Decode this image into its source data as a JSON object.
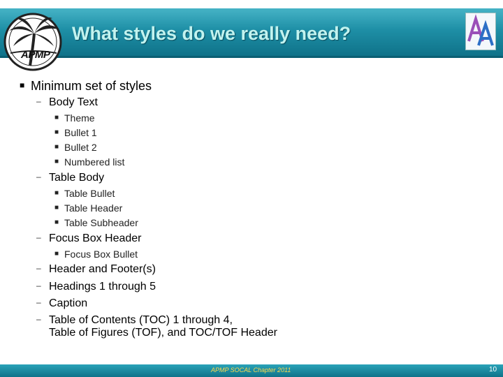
{
  "slide": {
    "title": "What styles do we really need?",
    "logo_text": "APMP",
    "logo_ring_text": "SOCAL CHAPTER",
    "footer": "APMP SOCAL Chapter 2011",
    "page_number": "10",
    "colors": {
      "band": "#1e8fa6",
      "title": "#c2f3ef",
      "footer_text": "#ffd84a"
    }
  },
  "bullets": {
    "main": "Minimum set of styles",
    "body_text": "Body Text",
    "body_sub": [
      "Theme",
      "Bullet 1",
      "Bullet 2",
      "Numbered list"
    ],
    "table_body": "Table Body",
    "table_sub": [
      "Table Bullet",
      "Table Header",
      "Table Subheader"
    ],
    "focus_box": "Focus Box Header",
    "focus_sub": [
      "Focus Box Bullet"
    ],
    "header_footer": "Header and Footer(s)",
    "headings": "Headings 1 through 5",
    "caption": "Caption",
    "toc_line1": "Table of Contents (TOC) 1 through 4,",
    "toc_line2": "Table of Figures (TOF), and TOC/TOF Header"
  },
  "icons": {
    "logo": "palm-tree-logo-icon",
    "corner": "font-aa-icon"
  }
}
